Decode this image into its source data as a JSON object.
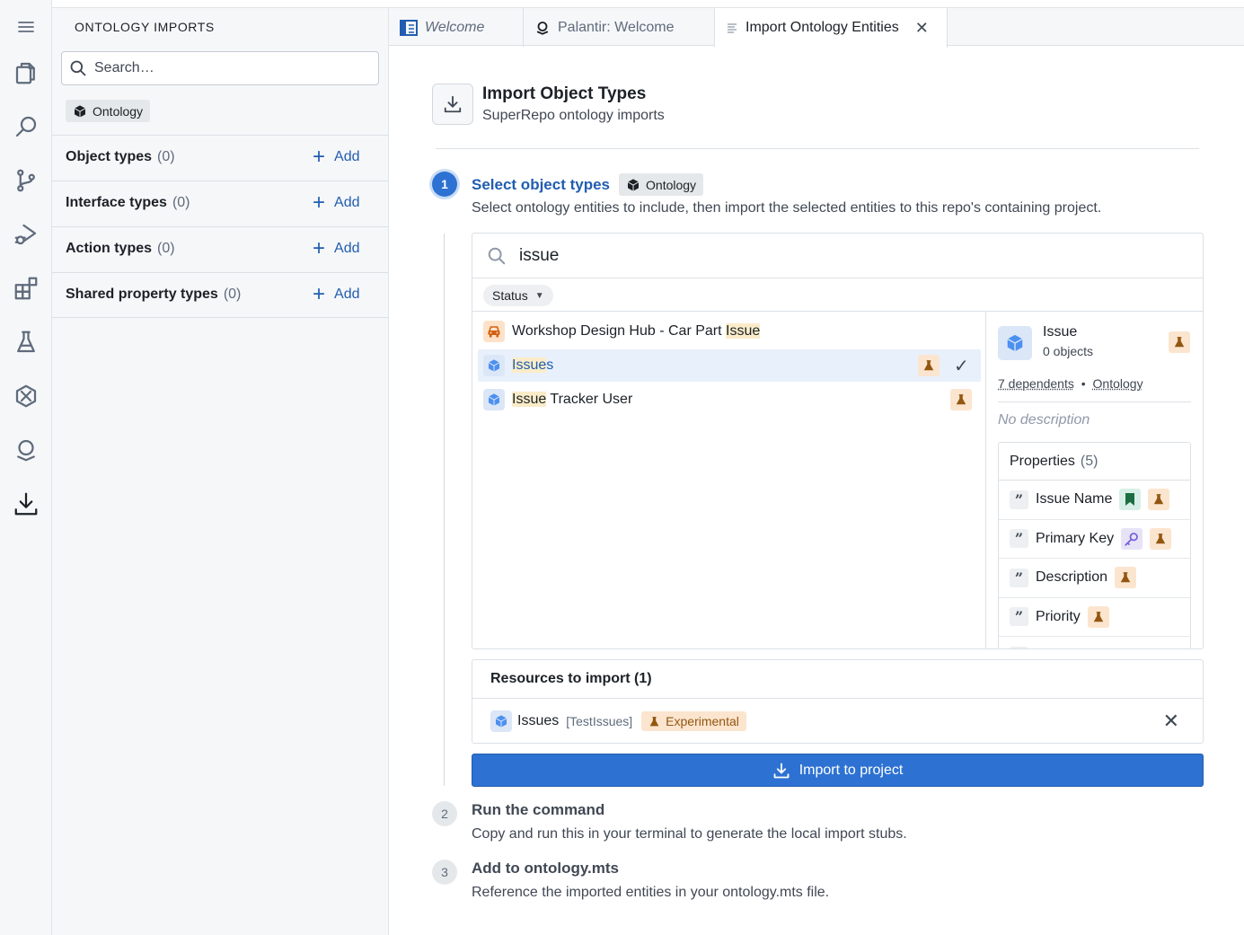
{
  "sidebar": {
    "title": "ONTOLOGY IMPORTS",
    "search_placeholder": "Search…",
    "chip_label": "Ontology",
    "sections": [
      {
        "label": "Object types",
        "count": "(0)",
        "add_label": "Add"
      },
      {
        "label": "Interface types",
        "count": "(0)",
        "add_label": "Add"
      },
      {
        "label": "Action types",
        "count": "(0)",
        "add_label": "Add"
      },
      {
        "label": "Shared property types",
        "count": "(0)",
        "add_label": "Add"
      }
    ]
  },
  "tabs": [
    {
      "label": "Welcome"
    },
    {
      "label": "Palantir: Welcome"
    },
    {
      "label": "Import Ontology Entities",
      "active": true
    }
  ],
  "header": {
    "title": "Import Object Types",
    "subtitle": "SuperRepo ontology imports"
  },
  "steps": [
    {
      "num": "1",
      "title": "Select object types",
      "chip": "Ontology",
      "desc": "Select ontology entities to include, then import the selected entities to this repo's containing project."
    },
    {
      "num": "2",
      "title": "Run the command",
      "desc": "Copy and run this in your terminal to generate the local import stubs."
    },
    {
      "num": "3",
      "title": "Add to ontology.mts",
      "desc": "Reference the imported entities in your ontology.mts file."
    }
  ],
  "picker": {
    "search_value": "issue",
    "filter_label": "Status",
    "results": [
      {
        "pre": "Workshop Design Hub - Car Part ",
        "hl": "Issue",
        "post": ""
      },
      {
        "pre": "",
        "hl": "Issue",
        "post": "s"
      },
      {
        "pre": "",
        "hl": "Issue",
        "post": " Tracker User"
      }
    ]
  },
  "detail": {
    "name": "Issue",
    "objects": "0 objects",
    "dependents": "7 dependents",
    "separator": "•",
    "ontology": "Ontology",
    "no_description": "No description",
    "properties_label": "Properties",
    "properties_count": "(5)",
    "properties": [
      "Issue Name",
      "Primary Key",
      "Description",
      "Priority"
    ]
  },
  "resources": {
    "title": "Resources to import (1)",
    "item_name": "Issues",
    "item_api": "[TestIssues]",
    "item_status": "Experimental"
  },
  "import_button": "Import to project",
  "colors": {
    "primary": "#2d72d2",
    "link": "#215db0",
    "experimental_bg": "#fbe5cf",
    "experimental_fg": "#935610",
    "highlight": "#fbecc9"
  }
}
